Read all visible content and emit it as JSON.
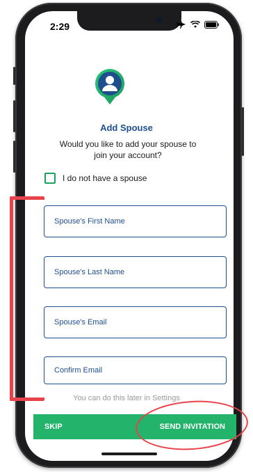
{
  "status_bar": {
    "time": "2:29",
    "icons": [
      "airplane-icon",
      "wifi-icon",
      "battery-icon"
    ]
  },
  "screen": {
    "title": "Add Spouse",
    "subtitle": "Would you like to add your spouse to join your account?",
    "no_spouse_label": "I do not have a spouse",
    "fields": {
      "first_name_placeholder": "Spouse's First Name",
      "last_name_placeholder": "Spouse's Last Name",
      "email_placeholder": "Spouse's Email",
      "confirm_email_placeholder": "Confirm Email"
    },
    "hint": "You can do this later in Settings",
    "actions": {
      "skip_label": "SKIP",
      "send_label": "SEND INVITATION"
    }
  },
  "colors": {
    "accent_green": "#23b36a",
    "brand_blue": "#1f4e8c",
    "annotation_red": "#e8424a"
  }
}
